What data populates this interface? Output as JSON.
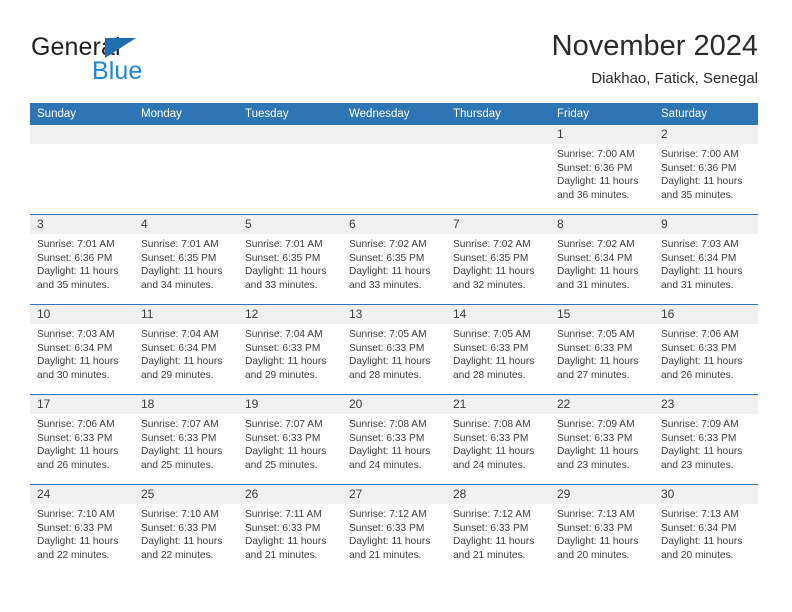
{
  "brand": {
    "name_part1": "General",
    "name_part2": "Blue",
    "flag_color": "#1f6cb0",
    "blue_color": "#1b87d4"
  },
  "header": {
    "title": "November 2024",
    "subtitle": "Diakhao, Fatick, Senegal"
  },
  "theme": {
    "header_bg": "#2e75b6",
    "date_band_bg": "#f0f0f0",
    "divider": "#2e75b6"
  },
  "weekdays": [
    "Sunday",
    "Monday",
    "Tuesday",
    "Wednesday",
    "Thursday",
    "Friday",
    "Saturday"
  ],
  "labels": {
    "sunrise": "Sunrise:",
    "sunset": "Sunset:",
    "daylight": "Daylight:"
  },
  "weeks": [
    [
      {
        "day": "",
        "empty": true
      },
      {
        "day": "",
        "empty": true
      },
      {
        "day": "",
        "empty": true
      },
      {
        "day": "",
        "empty": true
      },
      {
        "day": "",
        "empty": true
      },
      {
        "day": "1",
        "sunrise": "Sunrise: 7:00 AM",
        "sunset": "Sunset: 6:36 PM",
        "daylight": "Daylight: 11 hours and 36 minutes."
      },
      {
        "day": "2",
        "sunrise": "Sunrise: 7:00 AM",
        "sunset": "Sunset: 6:36 PM",
        "daylight": "Daylight: 11 hours and 35 minutes."
      }
    ],
    [
      {
        "day": "3",
        "sunrise": "Sunrise: 7:01 AM",
        "sunset": "Sunset: 6:36 PM",
        "daylight": "Daylight: 11 hours and 35 minutes."
      },
      {
        "day": "4",
        "sunrise": "Sunrise: 7:01 AM",
        "sunset": "Sunset: 6:35 PM",
        "daylight": "Daylight: 11 hours and 34 minutes."
      },
      {
        "day": "5",
        "sunrise": "Sunrise: 7:01 AM",
        "sunset": "Sunset: 6:35 PM",
        "daylight": "Daylight: 11 hours and 33 minutes."
      },
      {
        "day": "6",
        "sunrise": "Sunrise: 7:02 AM",
        "sunset": "Sunset: 6:35 PM",
        "daylight": "Daylight: 11 hours and 33 minutes."
      },
      {
        "day": "7",
        "sunrise": "Sunrise: 7:02 AM",
        "sunset": "Sunset: 6:35 PM",
        "daylight": "Daylight: 11 hours and 32 minutes."
      },
      {
        "day": "8",
        "sunrise": "Sunrise: 7:02 AM",
        "sunset": "Sunset: 6:34 PM",
        "daylight": "Daylight: 11 hours and 31 minutes."
      },
      {
        "day": "9",
        "sunrise": "Sunrise: 7:03 AM",
        "sunset": "Sunset: 6:34 PM",
        "daylight": "Daylight: 11 hours and 31 minutes."
      }
    ],
    [
      {
        "day": "10",
        "sunrise": "Sunrise: 7:03 AM",
        "sunset": "Sunset: 6:34 PM",
        "daylight": "Daylight: 11 hours and 30 minutes."
      },
      {
        "day": "11",
        "sunrise": "Sunrise: 7:04 AM",
        "sunset": "Sunset: 6:34 PM",
        "daylight": "Daylight: 11 hours and 29 minutes."
      },
      {
        "day": "12",
        "sunrise": "Sunrise: 7:04 AM",
        "sunset": "Sunset: 6:33 PM",
        "daylight": "Daylight: 11 hours and 29 minutes."
      },
      {
        "day": "13",
        "sunrise": "Sunrise: 7:05 AM",
        "sunset": "Sunset: 6:33 PM",
        "daylight": "Daylight: 11 hours and 28 minutes."
      },
      {
        "day": "14",
        "sunrise": "Sunrise: 7:05 AM",
        "sunset": "Sunset: 6:33 PM",
        "daylight": "Daylight: 11 hours and 28 minutes."
      },
      {
        "day": "15",
        "sunrise": "Sunrise: 7:05 AM",
        "sunset": "Sunset: 6:33 PM",
        "daylight": "Daylight: 11 hours and 27 minutes."
      },
      {
        "day": "16",
        "sunrise": "Sunrise: 7:06 AM",
        "sunset": "Sunset: 6:33 PM",
        "daylight": "Daylight: 11 hours and 26 minutes."
      }
    ],
    [
      {
        "day": "17",
        "sunrise": "Sunrise: 7:06 AM",
        "sunset": "Sunset: 6:33 PM",
        "daylight": "Daylight: 11 hours and 26 minutes."
      },
      {
        "day": "18",
        "sunrise": "Sunrise: 7:07 AM",
        "sunset": "Sunset: 6:33 PM",
        "daylight": "Daylight: 11 hours and 25 minutes."
      },
      {
        "day": "19",
        "sunrise": "Sunrise: 7:07 AM",
        "sunset": "Sunset: 6:33 PM",
        "daylight": "Daylight: 11 hours and 25 minutes."
      },
      {
        "day": "20",
        "sunrise": "Sunrise: 7:08 AM",
        "sunset": "Sunset: 6:33 PM",
        "daylight": "Daylight: 11 hours and 24 minutes."
      },
      {
        "day": "21",
        "sunrise": "Sunrise: 7:08 AM",
        "sunset": "Sunset: 6:33 PM",
        "daylight": "Daylight: 11 hours and 24 minutes."
      },
      {
        "day": "22",
        "sunrise": "Sunrise: 7:09 AM",
        "sunset": "Sunset: 6:33 PM",
        "daylight": "Daylight: 11 hours and 23 minutes."
      },
      {
        "day": "23",
        "sunrise": "Sunrise: 7:09 AM",
        "sunset": "Sunset: 6:33 PM",
        "daylight": "Daylight: 11 hours and 23 minutes."
      }
    ],
    [
      {
        "day": "24",
        "sunrise": "Sunrise: 7:10 AM",
        "sunset": "Sunset: 6:33 PM",
        "daylight": "Daylight: 11 hours and 22 minutes."
      },
      {
        "day": "25",
        "sunrise": "Sunrise: 7:10 AM",
        "sunset": "Sunset: 6:33 PM",
        "daylight": "Daylight: 11 hours and 22 minutes."
      },
      {
        "day": "26",
        "sunrise": "Sunrise: 7:11 AM",
        "sunset": "Sunset: 6:33 PM",
        "daylight": "Daylight: 11 hours and 21 minutes."
      },
      {
        "day": "27",
        "sunrise": "Sunrise: 7:12 AM",
        "sunset": "Sunset: 6:33 PM",
        "daylight": "Daylight: 11 hours and 21 minutes."
      },
      {
        "day": "28",
        "sunrise": "Sunrise: 7:12 AM",
        "sunset": "Sunset: 6:33 PM",
        "daylight": "Daylight: 11 hours and 21 minutes."
      },
      {
        "day": "29",
        "sunrise": "Sunrise: 7:13 AM",
        "sunset": "Sunset: 6:33 PM",
        "daylight": "Daylight: 11 hours and 20 minutes."
      },
      {
        "day": "30",
        "sunrise": "Sunrise: 7:13 AM",
        "sunset": "Sunset: 6:34 PM",
        "daylight": "Daylight: 11 hours and 20 minutes."
      }
    ]
  ]
}
